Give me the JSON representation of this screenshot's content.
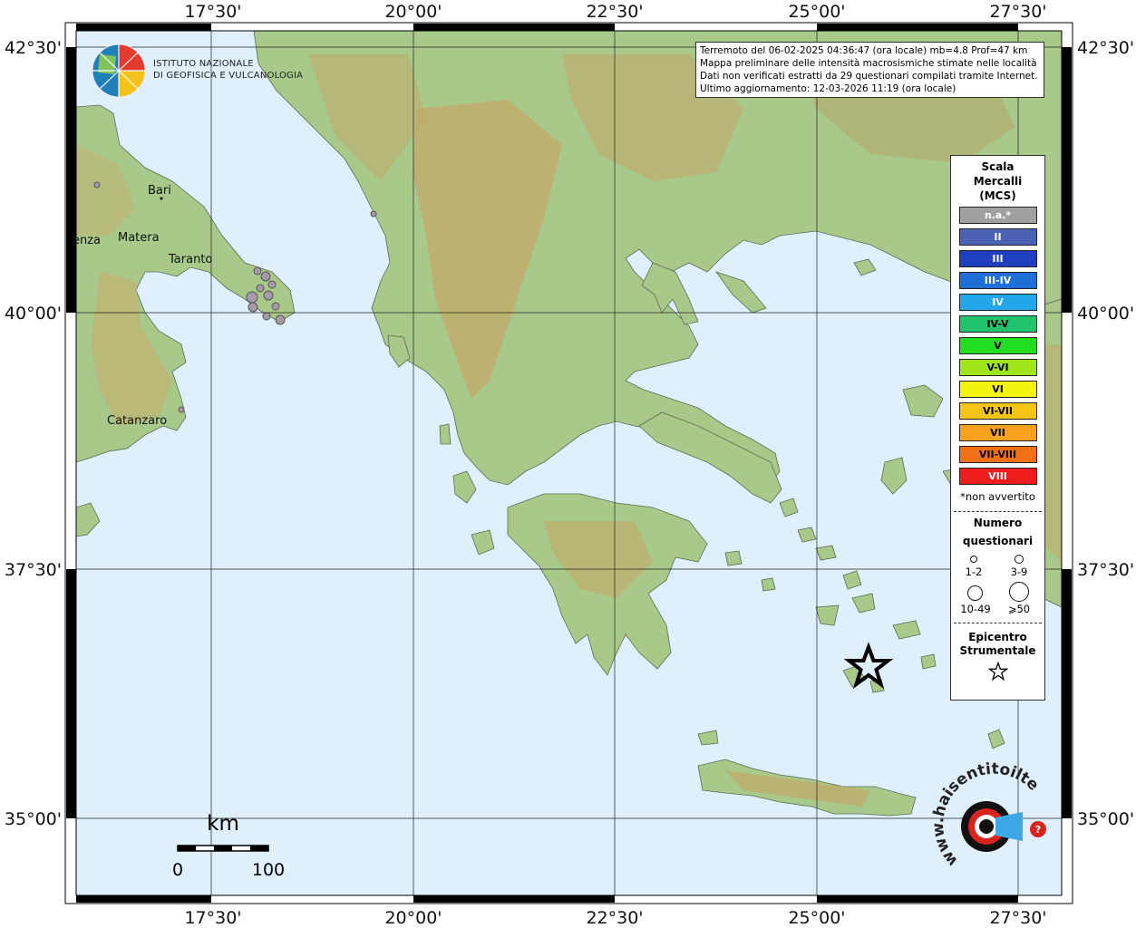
{
  "header_info": {
    "line1": "Terremoto del 06-02-2025 04:36:47 (ora locale) mb=4.8 Prof=47 km",
    "line2": "Mappa preliminare delle intensità macrosismiche stimate nelle località",
    "line3": "Dati non verificati estratti da 29 questionari compilati tramite Internet.",
    "line4": "Ultimo aggiornamento: 12-03-2026 11:19 (ora locale)"
  },
  "ingv_logo": {
    "line1": "ISTITUTO NAZIONALE",
    "line2": "DI GEOFISICA E VULCANOLOGIA",
    "icon": "globe-icon"
  },
  "axes": {
    "lon_labels": [
      "17°30'",
      "20°00'",
      "22°30'",
      "25°00'",
      "27°30'"
    ],
    "lat_labels": [
      "42°30'",
      "40°00'",
      "37°30'",
      "35°00'"
    ]
  },
  "cities": [
    "Bari",
    "Matera",
    "Taranto",
    "Catanzaro",
    "enza"
  ],
  "legend": {
    "title_lines": [
      "Scala",
      "Mercalli",
      "(MCS)"
    ],
    "scale": [
      {
        "label": "n.a.*",
        "color": "#a0a0a0",
        "text_color": "#ffffff"
      },
      {
        "label": "II",
        "color": "#4a63b5",
        "text_color": "#ffffff"
      },
      {
        "label": "III",
        "color": "#1f3fbf",
        "text_color": "#ffffff"
      },
      {
        "label": "III-IV",
        "color": "#1f6fd8",
        "text_color": "#ffffff"
      },
      {
        "label": "IV",
        "color": "#22a7ea",
        "text_color": "#ffffff"
      },
      {
        "label": "IV-V",
        "color": "#20c36e",
        "text_color": "#000000"
      },
      {
        "label": "V",
        "color": "#22dd22",
        "text_color": "#000000"
      },
      {
        "label": "V-VI",
        "color": "#9ee51c",
        "text_color": "#000000"
      },
      {
        "label": "VI",
        "color": "#f4f40e",
        "text_color": "#000000"
      },
      {
        "label": "VI-VII",
        "color": "#f5c515",
        "text_color": "#000000"
      },
      {
        "label": "VII",
        "color": "#f7a21c",
        "text_color": "#000000"
      },
      {
        "label": "VII-VIII",
        "color": "#f07018",
        "text_color": "#000000"
      },
      {
        "label": "VIII",
        "color": "#ee1c1c",
        "text_color": "#ffffff"
      }
    ],
    "note": "*non avvertito",
    "questionnaires_title_lines": [
      "Numero",
      "questionari"
    ],
    "sizes": [
      "1-2",
      "3-9",
      "10-49",
      "⩾50"
    ],
    "epicenter_title_lines": [
      "Epicentro",
      "Strumentale"
    ],
    "epicenter_icon": "star-icon"
  },
  "scalebar": {
    "unit": "km",
    "start": "0",
    "end": "100"
  },
  "haisentito_logo": {
    "text": "www.haisentitoilterremoto.it",
    "icon": "target-icon",
    "accent": "#d9231f"
  },
  "colors": {
    "sea": "#dfeffc",
    "land": "#a9c98a",
    "relief": "#c8a865",
    "frame": "#000000",
    "na_marker": "#a69aa8"
  }
}
